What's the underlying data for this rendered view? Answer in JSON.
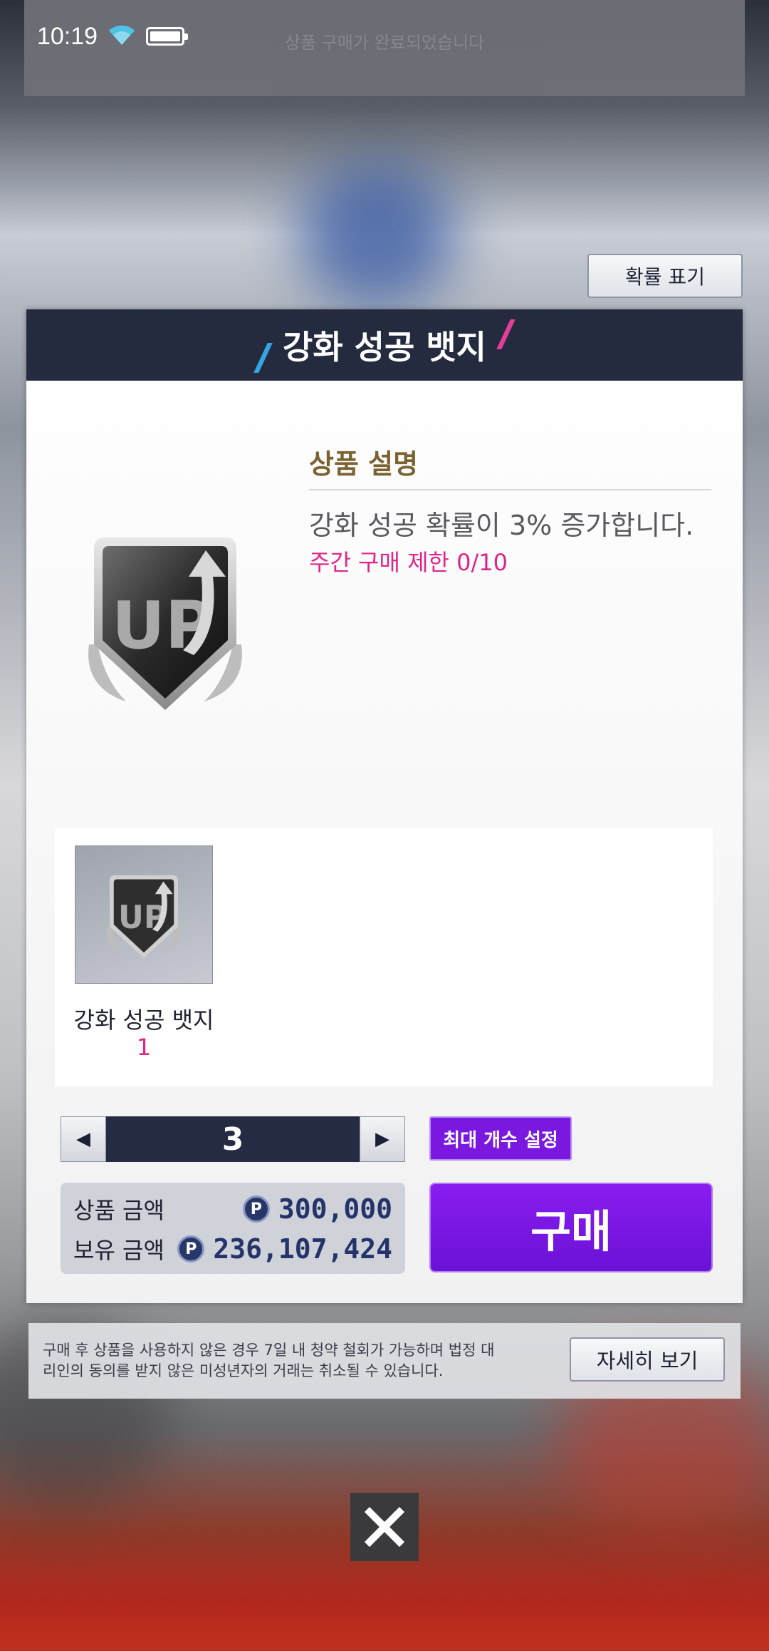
{
  "status_bar": {
    "time": "10:19"
  },
  "top_banner": {
    "faded_text": "상품 구매가 완료되었습니다"
  },
  "probability_button": "확률 표기",
  "panel": {
    "title": "강화 성공 뱃지",
    "description_title": "상품 설명",
    "description": "강화 성공 확률이 3% 증가합니다.",
    "weekly_limit": "주간 구매 제한 0/10",
    "icon": "up-badge-icon"
  },
  "items": [
    {
      "name": "강화 성공 뱃지",
      "count": "1",
      "icon": "up-badge-icon"
    }
  ],
  "quantity": {
    "value": "3",
    "decrease_icon": "triangle-left-icon",
    "increase_icon": "triangle-right-icon"
  },
  "max_button": "최대 개수 설정",
  "price": {
    "product_label": "상품 금액",
    "product_value": "300,000",
    "owned_label": "보유 금액",
    "owned_value": "236,107,424",
    "currency_icon_text": "P"
  },
  "buy_button": "구매",
  "notice": {
    "text": "구매 후 상품을 사용하지 않은 경우 7일 내 청약 철회가 가능하며 법정 대리인의 동의를 받지 않은 미성년자의 거래는 취소될 수 있습니다.",
    "detail_button": "자세히 보기"
  },
  "close_icon": "close-icon"
}
